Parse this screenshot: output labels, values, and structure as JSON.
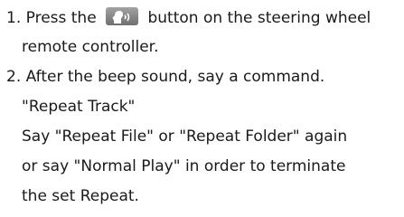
{
  "instructions": {
    "step1_before": "1. Press the",
    "step1_icon": "voice-command-icon",
    "step1_after": "button on the steering wheel",
    "step1_cont": "remote controller.",
    "step2": "2. After the beep sound, say a command.",
    "command": "\"Repeat Track\"",
    "note_line1": "Say \"Repeat File\" or \"Repeat Folder\" again",
    "note_line2": "or say \"Normal Play\" in order to terminate",
    "note_line3": "the set Repeat."
  }
}
